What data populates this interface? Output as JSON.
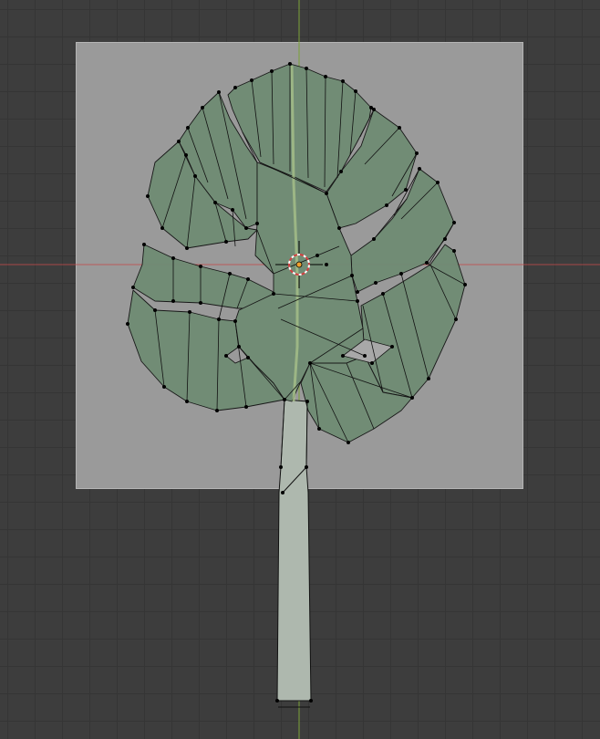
{
  "viewport": {
    "mode": "edit-mode",
    "object": "leaf-mesh",
    "grid": true,
    "axes": {
      "x_color": "#c24a4a",
      "y_color": "#7ca23a"
    }
  },
  "colors": {
    "background": "#3d3d3d",
    "grid_line": "#353535",
    "reference_plane": "#9a9a9a",
    "leaf_fill": "#6f8a73",
    "leaf_dark": "#3f6347",
    "stem_fill": "#aab6aa",
    "wire": "#111111",
    "vertex": "#000000",
    "origin": "#f0a030",
    "cursor_ring": "#ffffff",
    "cursor_ring_alt": "#d04040"
  },
  "icons": {
    "origin": "origin-point-icon",
    "cursor": "3d-cursor-icon"
  }
}
